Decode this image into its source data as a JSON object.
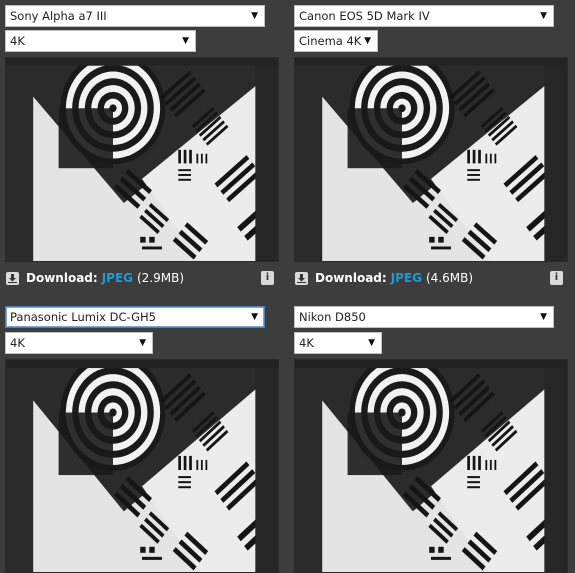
{
  "cells": [
    {
      "camera": "Sony Alpha a7 III",
      "mode": "4K",
      "download_label": "Download:",
      "format": "JPEG",
      "size": "(2.9MB)"
    },
    {
      "camera": "Canon EOS 5D Mark IV",
      "mode": "Cinema 4K",
      "download_label": "Download:",
      "format": "JPEG",
      "size": "(4.6MB)"
    },
    {
      "camera": "Panasonic Lumix DC-GH5",
      "mode": "4K"
    },
    {
      "camera": "Nikon D850",
      "mode": "4K"
    }
  ],
  "icons": {
    "dropdown": "chevron-down-icon",
    "download": "download-icon",
    "info": "info-icon"
  },
  "colors": {
    "background": "#3d3d3d",
    "link": "#1e9ad6",
    "focus": "#4a7fb8"
  }
}
